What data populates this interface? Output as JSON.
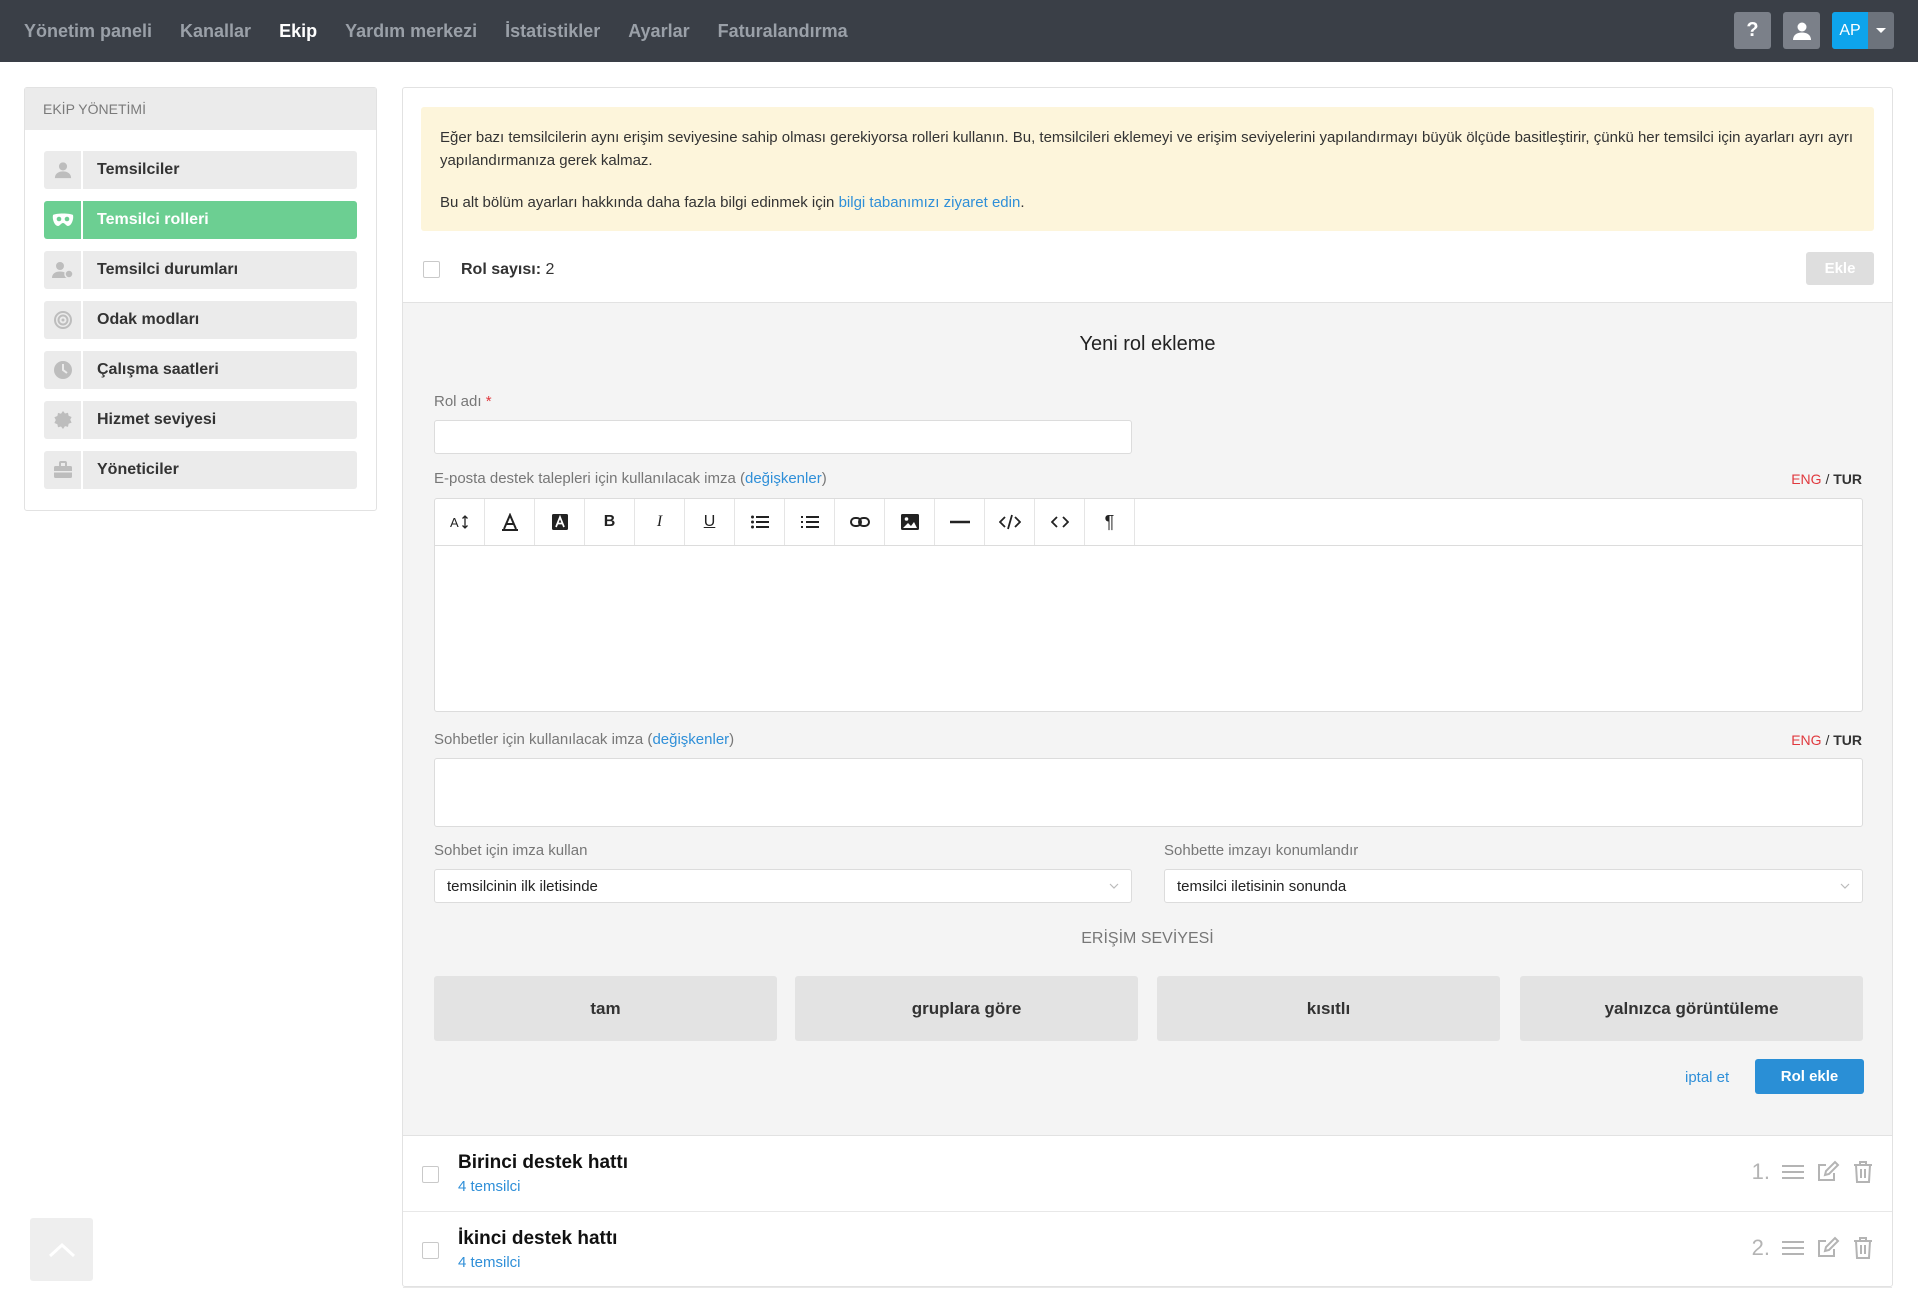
{
  "topnav": {
    "items": [
      {
        "label": "Yönetim paneli",
        "active": false
      },
      {
        "label": "Kanallar",
        "active": false
      },
      {
        "label": "Ekip",
        "active": true
      },
      {
        "label": "Yardım merkezi",
        "active": false
      },
      {
        "label": "İstatistikler",
        "active": false
      },
      {
        "label": "Ayarlar",
        "active": false
      },
      {
        "label": "Faturalandırma",
        "active": false
      }
    ],
    "help_icon": "question-icon",
    "user_icon": "user-icon",
    "avatar_initials": "AP"
  },
  "sidebar": {
    "title": "EKİP YÖNETİMİ",
    "items": [
      {
        "label": "Temsilciler",
        "icon": "person-icon",
        "active": false
      },
      {
        "label": "Temsilci rolleri",
        "icon": "mask-icon",
        "active": true
      },
      {
        "label": "Temsilci durumları",
        "icon": "person-status-icon",
        "active": false
      },
      {
        "label": "Odak modları",
        "icon": "target-icon",
        "active": false
      },
      {
        "label": "Çalışma saatleri",
        "icon": "clock-icon",
        "active": false
      },
      {
        "label": "Hizmet seviyesi",
        "icon": "badge-icon",
        "active": false
      },
      {
        "label": "Yöneticiler",
        "icon": "briefcase-icon",
        "active": false
      }
    ]
  },
  "notice": {
    "text1": "Eğer bazı temsilcilerin aynı erişim seviyesine sahip olması gerekiyorsa rolleri kullanın. Bu, temsilcileri eklemeyi ve erişim seviyelerini yapılandırmayı büyük ölçüde basitleştirir, çünkü her temsilci için ayarları ayrı ayrı yapılandırmanıza gerek kalmaz.",
    "text2_before": "Bu alt bölüm ayarları hakkında daha fazla bilgi edinmek için ",
    "text2_link": "bilgi tabanımızı ziyaret edin",
    "text2_after": "."
  },
  "role_count": {
    "label": "Rol sayısı:",
    "value": "2",
    "add_button": "Ekle"
  },
  "form": {
    "title": "Yeni rol ekleme",
    "role_name_label": "Rol adı",
    "role_name_required": "*",
    "role_name_value": "",
    "email_sig_label": "E-posta destek talepleri için kullanılacak imza (",
    "email_sig_link": "değişkenler",
    "email_sig_close": ")",
    "chat_sig_label": "Sohbetler için kullanılacak imza (",
    "chat_sig_link": "değişkenler",
    "chat_sig_close": ")",
    "lang_eng": "ENG",
    "lang_sep": "/",
    "lang_tur": "TUR",
    "toolbar": [
      "font-size-icon",
      "font-color-icon",
      "background-color-icon",
      "bold-icon",
      "italic-icon",
      "underline-icon",
      "bullet-list-icon",
      "numbered-list-icon",
      "link-icon",
      "image-icon",
      "horizontal-rule-icon",
      "code-view-icon",
      "code-icon",
      "paragraph-icon"
    ],
    "use_sig_label": "Sohbet için imza kullan",
    "use_sig_value": "temsilcinin ilk iletisinde",
    "position_sig_label": "Sohbette imzayı konumlandır",
    "position_sig_value": "temsilci iletisinin sonunda",
    "access_title": "ERİŞİM SEVİYESİ",
    "access_options": [
      "tam",
      "gruplara göre",
      "kısıtlı",
      "yalnızca görüntüleme"
    ],
    "cancel": "iptal et",
    "submit": "Rol ekle"
  },
  "roles": [
    {
      "name": "Birinci destek hattı",
      "count": "4 temsilci",
      "order": "1."
    },
    {
      "name": "İkinci destek hattı",
      "count": "4 temsilci",
      "order": "2."
    }
  ],
  "colors": {
    "topbar": "#3a3f47",
    "active_sidebar": "#6ccf92",
    "link": "#2f8fd8",
    "primary_button": "#2a8fd6",
    "avatar": "#0ea4ec",
    "required": "#e0393e",
    "notice_bg": "#fdf5db"
  }
}
